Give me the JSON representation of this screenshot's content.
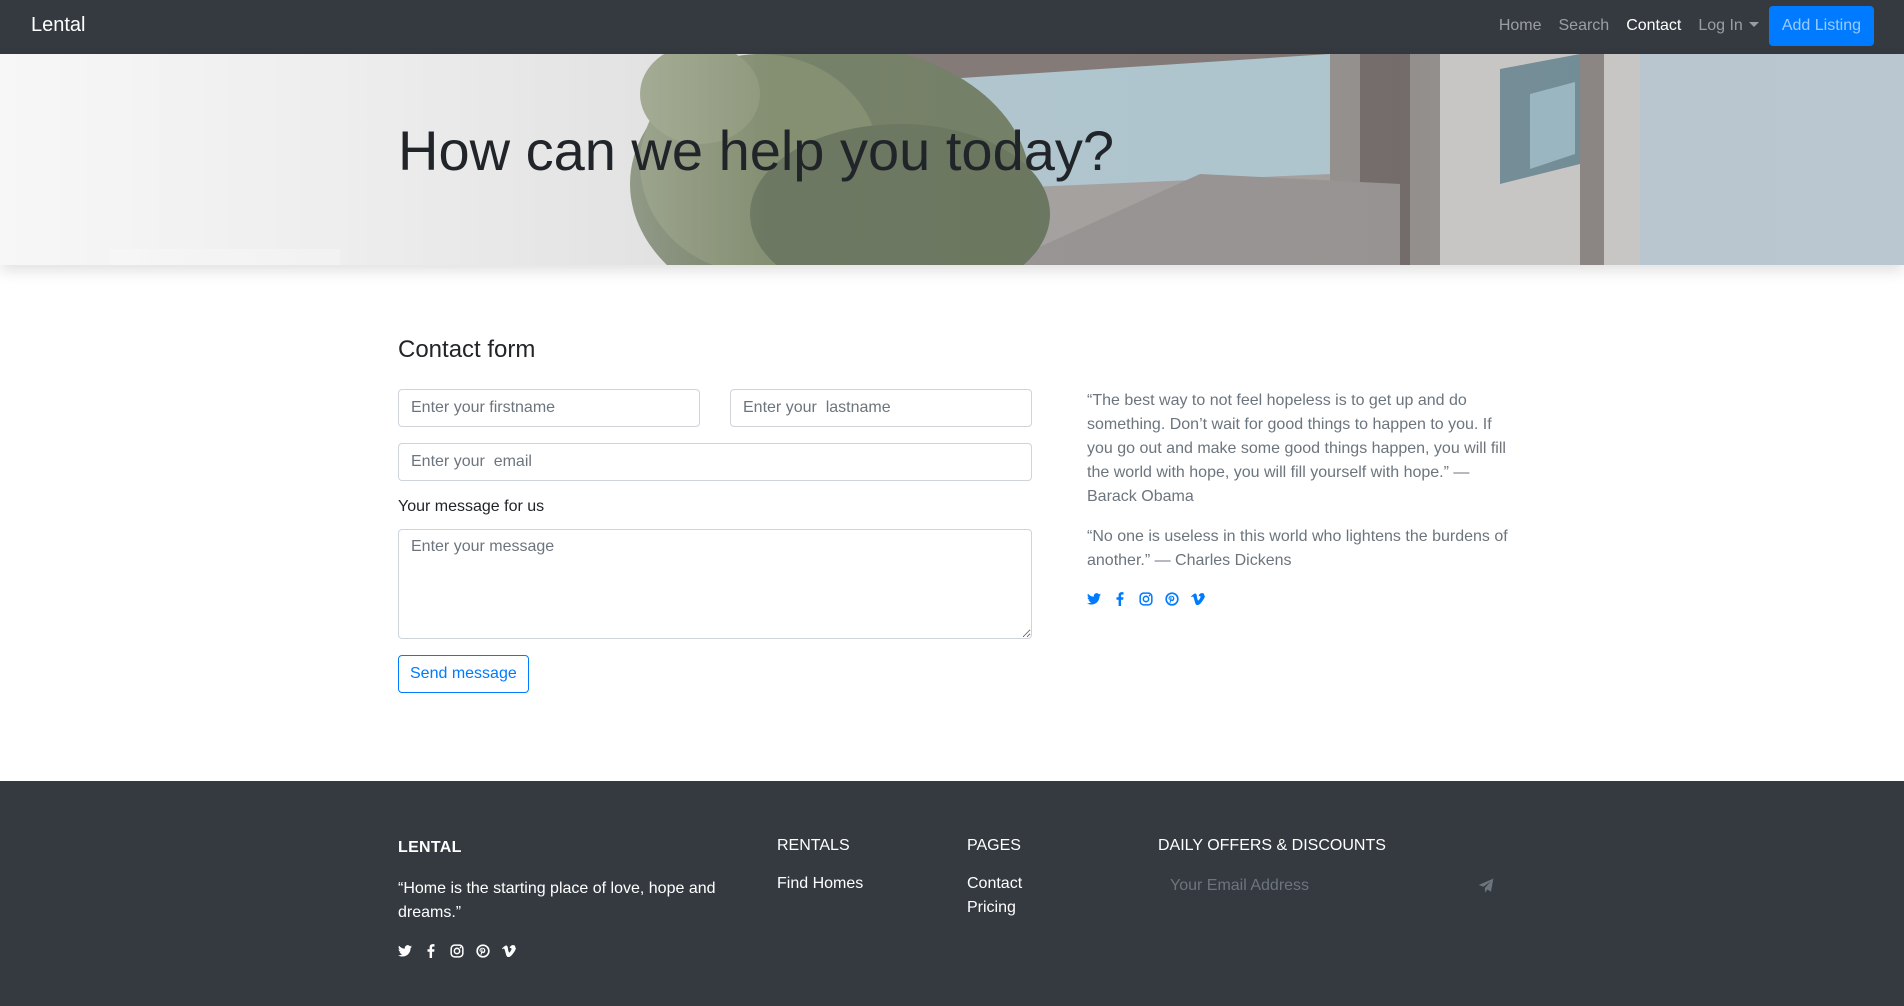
{
  "navbar": {
    "brand": "Lental",
    "links": [
      {
        "label": "Home"
      },
      {
        "label": "Search"
      },
      {
        "label": "Contact"
      },
      {
        "label": "Log In"
      }
    ],
    "add_listing": "Add Listing",
    "active_link": "Contact"
  },
  "hero": {
    "title": "How can we help you today?"
  },
  "contact_form": {
    "heading": "Contact form",
    "firstname_placeholder": "Enter your firstname",
    "lastname_placeholder": "Enter your  lastname",
    "email_placeholder": "Enter your  email",
    "message_label": "Your message for us",
    "message_placeholder": "Enter your message",
    "submit_label": "Send message"
  },
  "quotes": [
    "“The best way to not feel hopeless is to get up and do something. Don’t wait for good things to happen to you. If you go out and make some good things happen, you will fill the world with hope, you will fill yourself with hope.” — Barack Obama",
    "“No one is useless in this world who lightens the burdens of another.” — Charles Dickens"
  ],
  "social_icons": [
    "twitter-icon",
    "facebook-icon",
    "instagram-icon",
    "pinterest-icon",
    "vimeo-icon"
  ],
  "footer": {
    "brand": "LENTAL",
    "tagline": "“Home is the starting place of love, hope and dreams.”",
    "rentals": {
      "title": "RENTALS",
      "links": [
        "Find Homes"
      ]
    },
    "pages": {
      "title": "PAGES",
      "links": [
        "Contact",
        "Pricing"
      ]
    },
    "offers": {
      "title": "DAILY OFFERS & DISCOUNTS",
      "email_placeholder": "Your Email Address"
    }
  },
  "colors": {
    "navbar_bg": "#343a40",
    "primary": "#007bff",
    "muted_text": "#6c757d",
    "footer_bg": "#343a40"
  }
}
